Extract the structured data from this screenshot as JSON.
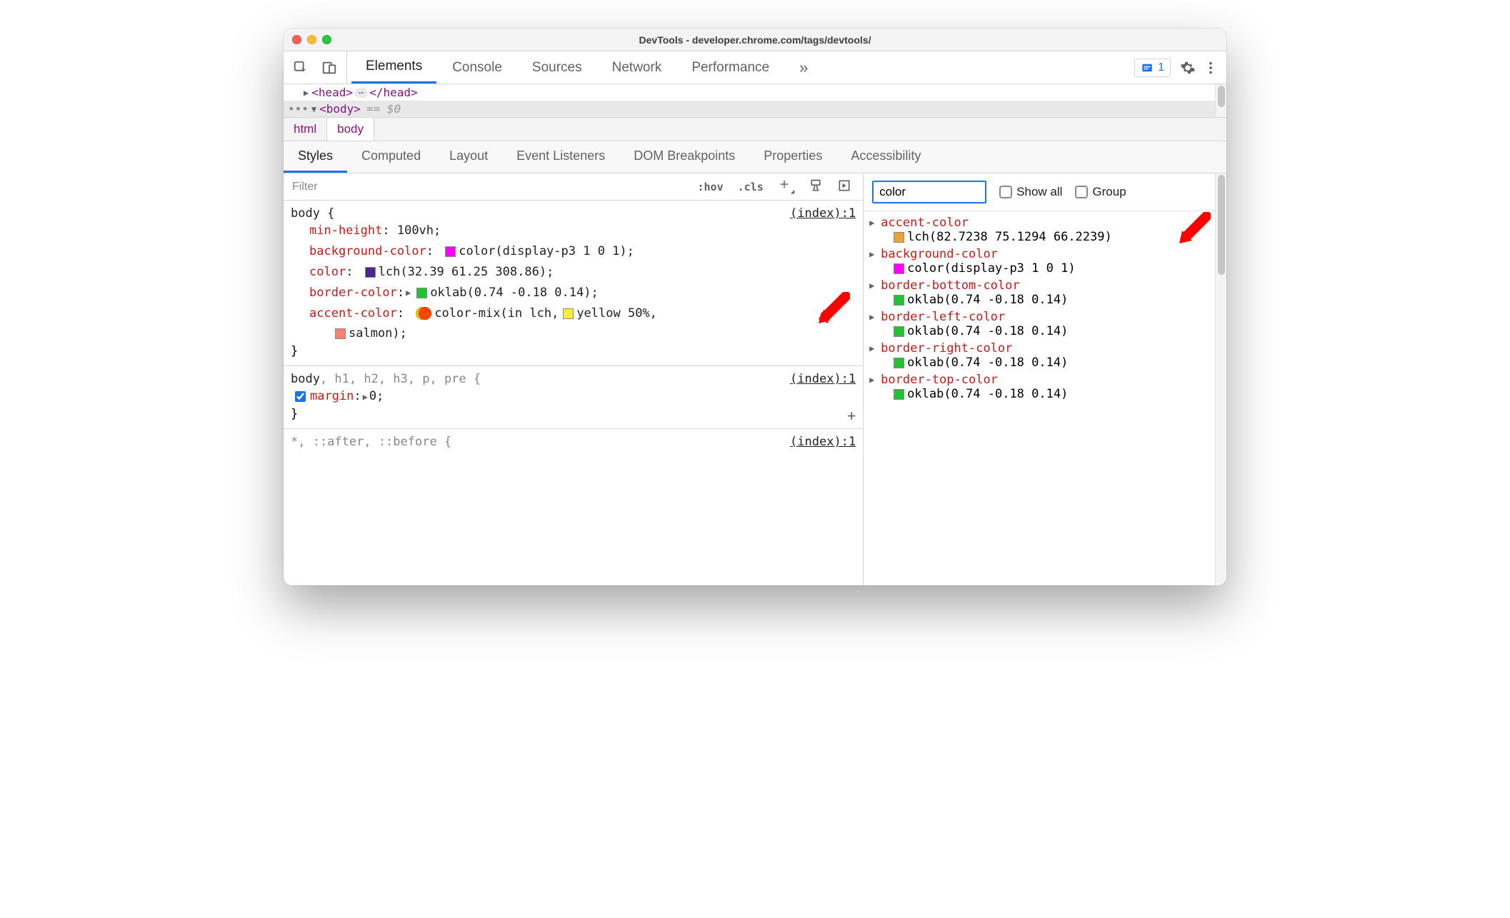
{
  "window": {
    "title": "DevTools - developer.chrome.com/tags/devtools/"
  },
  "tabs": {
    "main": [
      "Elements",
      "Console",
      "Sources",
      "Network",
      "Performance"
    ],
    "activeIndex": 0,
    "overflow": "»"
  },
  "issuesChip": {
    "count": "1"
  },
  "dom": {
    "head": {
      "open": "<head>",
      "close": "</head>"
    },
    "body": {
      "open": "<body>",
      "eq": "== $0"
    },
    "prefix": "•••"
  },
  "breadcrumbs": [
    "html",
    "body"
  ],
  "subtabs": [
    "Styles",
    "Computed",
    "Layout",
    "Event Listeners",
    "DOM Breakpoints",
    "Properties",
    "Accessibility"
  ],
  "subtabActiveIndex": 0,
  "styles": {
    "filterPlaceholder": "Filter",
    "hov": ":hov",
    "cls": ".cls",
    "rules": [
      {
        "selector": "body {",
        "source": "(index):1",
        "decls": [
          {
            "prop": "min-height",
            "value": "100vh",
            "swatch": null
          },
          {
            "prop": "background-color",
            "value": "color(display-p3 1 0 1)",
            "swatch": "#ff00ff"
          },
          {
            "prop": "color",
            "value": "lch(32.39 61.25 308.86)",
            "swatch": "#4b2a8f"
          },
          {
            "prop": "border-color",
            "value": "oklab(0.74 -0.18 0.14)",
            "swatch": "#23c234",
            "expandable": true
          },
          {
            "prop": "accent-color",
            "value_pre": "color-mix(in lch, ",
            "mix": true,
            "mix_yellow": "yellow 50%",
            "swatch_yellow": "#ffeb3b",
            "value_post": ",",
            "cont_swatch": "#fa8072",
            "cont_text": "salmon);"
          }
        ],
        "close": "}"
      },
      {
        "selector_parts": {
          "main": "body",
          "rest": ", h1, h2, h3, p, pre {"
        },
        "source": "(index):1",
        "decls": [
          {
            "prop": "margin",
            "value": "0",
            "checkbox": true,
            "expandable": true
          }
        ],
        "close": "}"
      },
      {
        "selector_raw": "*, ::after, ::before {",
        "source": "(index):1",
        "truncated": true
      }
    ]
  },
  "computed": {
    "filterValue": "color",
    "showAll": "Show all",
    "group": "Group",
    "items": [
      {
        "prop": "accent-color",
        "swatch": "#e8a33a",
        "value": "lch(82.7238 75.1294 66.2239)"
      },
      {
        "prop": "background-color",
        "swatch": "#ff00ff",
        "value": "color(display-p3 1 0 1)"
      },
      {
        "prop": "border-bottom-color",
        "swatch": "#23c234",
        "value": "oklab(0.74 -0.18 0.14)"
      },
      {
        "prop": "border-left-color",
        "swatch": "#23c234",
        "value": "oklab(0.74 -0.18 0.14)"
      },
      {
        "prop": "border-right-color",
        "swatch": "#23c234",
        "value": "oklab(0.74 -0.18 0.14)"
      },
      {
        "prop": "border-top-color",
        "swatch": "#23c234",
        "value": "oklab(0.74 -0.18 0.14)",
        "truncated": true
      }
    ]
  },
  "annotations": {
    "arrow_left": true,
    "arrow_right": true
  }
}
